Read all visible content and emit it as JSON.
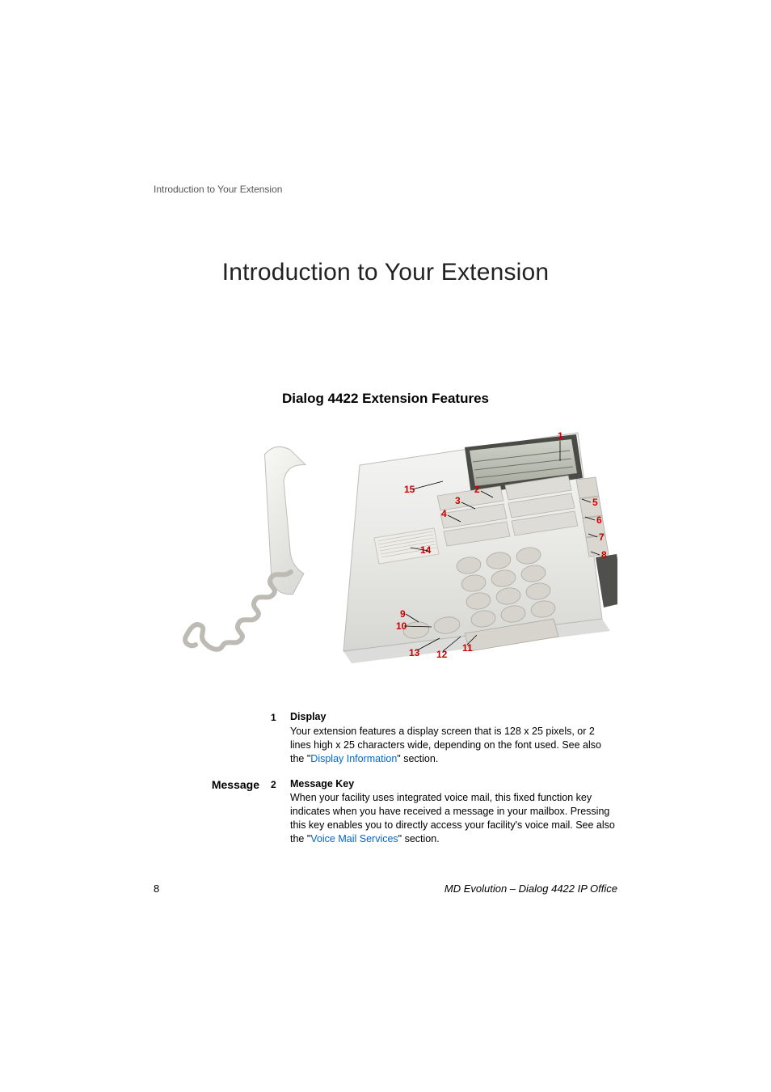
{
  "header_trail": "Introduction to Your Extension",
  "title": "Introduction to Your Extension",
  "section_title": "Dialog 4422 Extension Features",
  "figure": {
    "callouts": [
      "1",
      "2",
      "3",
      "4",
      "5",
      "6",
      "7",
      "8",
      "9",
      "10",
      "11",
      "12",
      "13",
      "14",
      "15"
    ]
  },
  "items": [
    {
      "left_label": "",
      "num": "1",
      "title": "Display",
      "body_before": "Your extension features a display screen that is 128 x 25 pixels, or 2 lines high x 25 characters wide, depending on the font used. See also the \"",
      "link": "Display Information",
      "body_after": "\" section."
    },
    {
      "left_label": "Message",
      "num": "2",
      "title": "Message Key",
      "body_before": "When your facility uses integrated voice mail, this fixed function key indicates when you have received a message in your mailbox. Pressing this key enables you to directly access your facility's voice mail. See also the \"",
      "link": "Voice Mail Services",
      "body_after": "\" section."
    }
  ],
  "page_number": "8",
  "footer_model": "MD Evolution – Dialog 4422 IP Office"
}
